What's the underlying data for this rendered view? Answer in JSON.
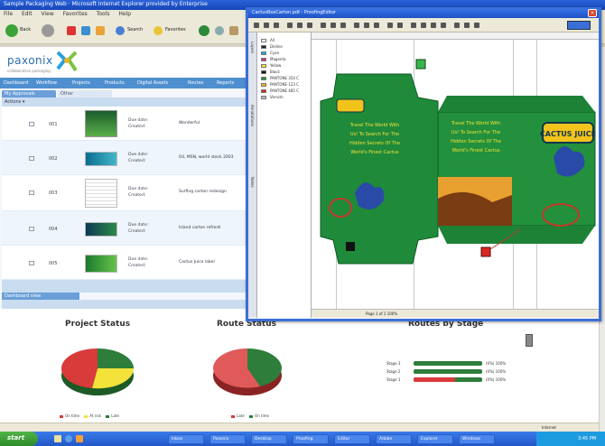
{
  "browser": {
    "title": "Sample Packaging Web · Microsoft Internet Explorer provided by Enterprise",
    "menu": [
      "File",
      "Edit",
      "View",
      "Favorites",
      "Tools",
      "Help"
    ],
    "toolbar": {
      "back_label": "Back",
      "search_label": "Search",
      "favorites_label": "Favorites"
    },
    "status_internet": "Internet"
  },
  "app": {
    "logo_text": "paxonix",
    "logo_sub": "collaborative packaging",
    "nav": [
      "Dashboard",
      "Workflow",
      "Projects",
      "Products",
      "Digital Assets",
      "Routes",
      "Reports"
    ],
    "list_tab": "My Approvals",
    "list_tab_alt": "Other",
    "list_toolbar": "Actions ▾",
    "rows": [
      {
        "id": "001",
        "meta1": "Due date:",
        "meta2": "Created:",
        "name": "Wonderful"
      },
      {
        "id": "002",
        "meta1": "Due date:",
        "meta2": "Created:",
        "name": "Oil, MSN, world stock 2003"
      },
      {
        "id": "003",
        "meta1": "Due date:",
        "meta2": "Created:",
        "name": "Surfing carton redesign"
      },
      {
        "id": "004",
        "meta1": "Due date:",
        "meta2": "Created:",
        "name": "Island carton refresh"
      },
      {
        "id": "005",
        "meta1": "Due date:",
        "meta2": "Created:",
        "name": "Cactus Juice label"
      }
    ],
    "dash_tab": "Dashboard view",
    "charts": {
      "project_status_title": "Project Status",
      "route_status_title": "Route Status",
      "routes_by_stage_title": "Routes by Stage",
      "project_legend": [
        "On time",
        "At risk",
        "Late"
      ],
      "route_legend": [
        "Late",
        "On time"
      ],
      "stage_labels": [
        "Stage 3",
        "Stage 2",
        "Stage 1"
      ],
      "stage_values": [
        "(0%) 100%",
        "(0%) 100%",
        "(0%) 100%"
      ],
      "colors": {
        "green": "#2e7d3a",
        "yellow": "#f2e23a",
        "red": "#d93a3a"
      }
    }
  },
  "editor": {
    "title": "CactusBoxCarton.pdf - ProofingEditor",
    "close_label": "×",
    "side_tabs": [
      "Layers",
      "Annotations",
      "Notes"
    ],
    "layers": [
      "All",
      "Dieline",
      "Cyan",
      "Magenta",
      "Yellow",
      "Black",
      "PANTONE 354 C",
      "PANTONE 123 C",
      "PANTONE 485 C",
      "Varnish"
    ],
    "layer_colors": [
      "#ffffff",
      "#222222",
      "#22a7e0",
      "#d0308a",
      "#f2e23a",
      "#111111",
      "#1a9a3a",
      "#f6b01a",
      "#d9281f",
      "#bbbbbb"
    ],
    "status": "Page 1 of 1   100%",
    "carton": {
      "brand": "CACTUS JUICE",
      "panel_text": [
        "Travel The World With",
        "Us! To Search For The",
        "Hidden Secrets Of The",
        "World's Finest Cactus"
      ]
    }
  },
  "taskbar": {
    "start": "start",
    "tasks": [
      "Inbox",
      "Paxonix",
      "Desktop",
      "Proofing",
      "Editor",
      "Adobe",
      "Explorer",
      "Windows"
    ],
    "clock": "3:45 PM"
  }
}
